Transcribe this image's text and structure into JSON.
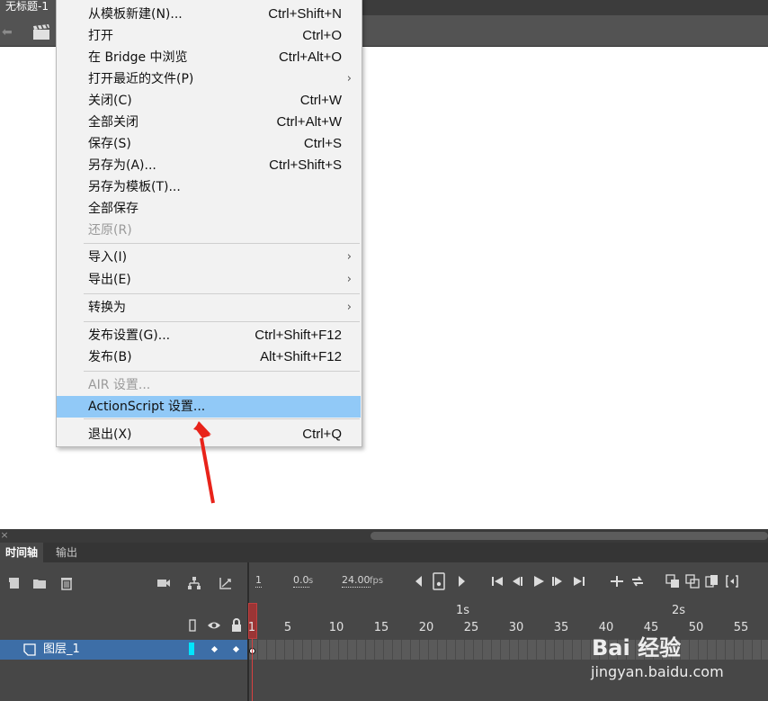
{
  "document_tab": {
    "title": "无标题-1"
  },
  "menu": {
    "items": [
      {
        "label": "从模板新建(N)...",
        "shortcut": "Ctrl+Shift+N",
        "disabled": false,
        "submenu": false
      },
      {
        "label": "打开",
        "shortcut": "Ctrl+O",
        "disabled": false,
        "submenu": false
      },
      {
        "label": "在 Bridge 中浏览",
        "shortcut": "Ctrl+Alt+O",
        "disabled": false,
        "submenu": false
      },
      {
        "label": "打开最近的文件(P)",
        "shortcut": "",
        "disabled": false,
        "submenu": true
      },
      {
        "label": "关闭(C)",
        "shortcut": "Ctrl+W",
        "disabled": false,
        "submenu": false
      },
      {
        "label": "全部关闭",
        "shortcut": "Ctrl+Alt+W",
        "disabled": false,
        "submenu": false
      },
      {
        "label": "保存(S)",
        "shortcut": "Ctrl+S",
        "disabled": false,
        "submenu": false
      },
      {
        "label": "另存为(A)...",
        "shortcut": "Ctrl+Shift+S",
        "disabled": false,
        "submenu": false
      },
      {
        "label": "另存为模板(T)...",
        "shortcut": "",
        "disabled": false,
        "submenu": false
      },
      {
        "label": "全部保存",
        "shortcut": "",
        "disabled": false,
        "submenu": false
      },
      {
        "label": "还原(R)",
        "shortcut": "",
        "disabled": true,
        "submenu": false
      },
      {
        "label": "导入(I)",
        "shortcut": "",
        "disabled": false,
        "submenu": true
      },
      {
        "label": "导出(E)",
        "shortcut": "",
        "disabled": false,
        "submenu": true
      },
      {
        "label": "转换为",
        "shortcut": "",
        "disabled": false,
        "submenu": true
      },
      {
        "label": "发布设置(G)...",
        "shortcut": "Ctrl+Shift+F12",
        "disabled": false,
        "submenu": false
      },
      {
        "label": "发布(B)",
        "shortcut": "Alt+Shift+F12",
        "disabled": false,
        "submenu": false
      },
      {
        "label": "AIR 设置...",
        "shortcut": "",
        "disabled": true,
        "submenu": false
      },
      {
        "label": "ActionScript 设置...",
        "shortcut": "",
        "disabled": false,
        "submenu": false,
        "highlighted": true
      },
      {
        "label": "退出(X)",
        "shortcut": "Ctrl+Q",
        "disabled": false,
        "submenu": false
      }
    ],
    "submenu_arrow": "›",
    "highlight_color": "#91c9f7"
  },
  "timeline_panel": {
    "tabs": [
      {
        "label": "时间轴",
        "active": true
      },
      {
        "label": "输出",
        "active": false
      }
    ],
    "current_frame": "1",
    "elapsed_time": "0.0",
    "time_unit": "s",
    "frame_rate": "24.00",
    "frame_rate_unit": "fps",
    "ruler": {
      "frame_labels": [
        "1",
        "5",
        "10",
        "15",
        "20",
        "25",
        "30",
        "35",
        "40",
        "45",
        "50",
        "55"
      ],
      "second_labels": [
        "1s",
        "2s"
      ]
    },
    "layers": [
      {
        "name": "图层_1",
        "color": "#00e5ff"
      }
    ],
    "icons": [
      "new-layer-icon",
      "new-folder-icon",
      "delete-layer-icon",
      "camera-icon",
      "layer-parenting-icon",
      "graph-icon",
      "outline-icon",
      "eye-icon",
      "lock-icon",
      "step-back-icon",
      "insert-keyframe-icon",
      "step-forward-icon",
      "go-first-icon",
      "prev-frame-icon",
      "play-icon",
      "next-frame-icon",
      "go-last-icon",
      "center-frame-icon",
      "loop-icon",
      "onion-skin-icon",
      "onion-outline-icon",
      "edit-multiple-icon",
      "modify-markers-icon"
    ]
  },
  "watermark": {
    "logo": "Bai 经验",
    "url": "jingyan.baidu.com"
  }
}
